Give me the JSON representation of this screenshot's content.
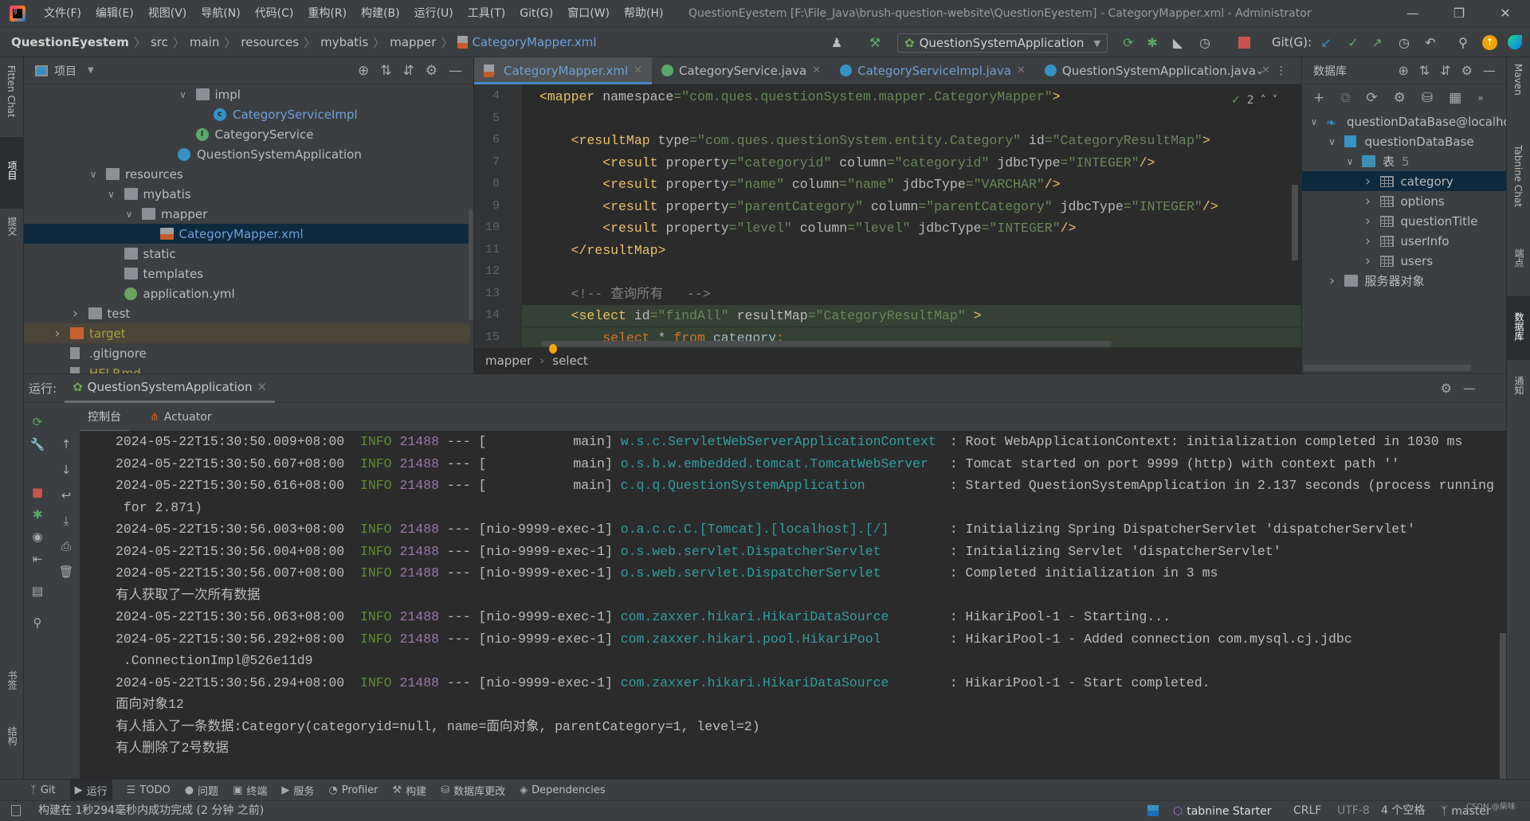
{
  "menu": [
    "文件(F)",
    "编辑(E)",
    "视图(V)",
    "导航(N)",
    "代码(C)",
    "重构(R)",
    "构建(B)",
    "运行(U)",
    "工具(T)",
    "Git(G)",
    "窗口(W)",
    "帮助(H)"
  ],
  "window_title": "QuestionEyestem [F:\\File_Java\\brush-question-website\\QuestionEyestem] - CategoryMapper.xml - Administrator",
  "breadcrumb": {
    "root": "QuestionEyestem",
    "parts": [
      "src",
      "main",
      "resources",
      "mybatis",
      "mapper"
    ],
    "current": "CategoryMapper.xml"
  },
  "toolbar": {
    "run_config": "QuestionSystemApplication",
    "git_label": "Git(G):"
  },
  "left_stripe": [
    "Fitten Chat",
    "项目",
    "提交",
    "书签",
    "结构"
  ],
  "right_stripe": [
    "Maven",
    "Tabnine Chat",
    "端点",
    "数据库",
    "通知"
  ],
  "project": {
    "title": "项目",
    "tree": [
      {
        "label": "impl",
        "depth": 7,
        "type": "folder",
        "expanded": true
      },
      {
        "label": "CategoryServiceImpl",
        "depth": 8,
        "type": "class",
        "color": "#6f9fd8"
      },
      {
        "label": "CategoryService",
        "depth": 7,
        "type": "interface"
      },
      {
        "label": "QuestionSystemApplication",
        "depth": 6,
        "type": "spring-class"
      },
      {
        "label": "resources",
        "depth": 2,
        "type": "folder",
        "expanded": true
      },
      {
        "label": "mybatis",
        "depth": 3,
        "type": "folder",
        "expanded": true
      },
      {
        "label": "mapper",
        "depth": 4,
        "type": "folder",
        "expanded": true
      },
      {
        "label": "CategoryMapper.xml",
        "depth": 5,
        "type": "xml",
        "selected": true,
        "color": "#6f9fd8"
      },
      {
        "label": "static",
        "depth": 3,
        "type": "folder"
      },
      {
        "label": "templates",
        "depth": 3,
        "type": "folder"
      },
      {
        "label": "application.yml",
        "depth": 3,
        "type": "yml"
      },
      {
        "label": "test",
        "depth": 1,
        "type": "folder",
        "expanded": false
      },
      {
        "label": "target",
        "depth": 0,
        "type": "folder-orange",
        "expanded": false,
        "excluded": true,
        "color": "#a8a13a"
      },
      {
        "label": ".gitignore",
        "depth": 0,
        "type": "file"
      },
      {
        "label": "HELP.md",
        "depth": 0,
        "type": "file",
        "color": "#a8a13a"
      }
    ]
  },
  "editor": {
    "tabs": [
      {
        "label": "CategoryMapper.xml",
        "icon": "xml-file-icon",
        "active": true
      },
      {
        "label": "CategoryService.java",
        "icon": "interface-icon"
      },
      {
        "label": "CategoryServiceImpl.java",
        "icon": "class-icon"
      },
      {
        "label": "QuestionSystemApplication.java",
        "icon": "spring-class-icon"
      }
    ],
    "inspection_count": "2",
    "lines": [
      {
        "n": "4",
        "tokens": [
          [
            "<mapper ",
            "tag"
          ],
          [
            "namespace",
            "attr"
          ],
          [
            "=\"com.ques.questionSystem.mapper.CategoryMapper\"",
            "val"
          ],
          [
            ">",
            "tag"
          ]
        ]
      },
      {
        "n": "5",
        "tokens": []
      },
      {
        "n": "6",
        "tokens": [
          [
            "    <resultMap ",
            "tag"
          ],
          [
            "type",
            "attr"
          ],
          [
            "=\"com.ques.questionSystem.entity.Category\" ",
            "val"
          ],
          [
            "id",
            "attr"
          ],
          [
            "=\"CategoryResultMap\"",
            "val"
          ],
          [
            ">",
            "tag"
          ]
        ]
      },
      {
        "n": "7",
        "tokens": [
          [
            "        <result ",
            "tag"
          ],
          [
            "property",
            "attr"
          ],
          [
            "=\"categoryid\" ",
            "val"
          ],
          [
            "column",
            "attr"
          ],
          [
            "=\"categoryid\" ",
            "val"
          ],
          [
            "jdbcType",
            "attr"
          ],
          [
            "=\"INTEGER\"",
            "val"
          ],
          [
            "/>",
            "tag"
          ]
        ]
      },
      {
        "n": "8",
        "tokens": [
          [
            "        <result ",
            "tag"
          ],
          [
            "property",
            "attr"
          ],
          [
            "=\"name\" ",
            "val"
          ],
          [
            "column",
            "attr"
          ],
          [
            "=\"name\" ",
            "val"
          ],
          [
            "jdbcType",
            "attr"
          ],
          [
            "=\"VARCHAR\"",
            "val"
          ],
          [
            "/>",
            "tag"
          ]
        ]
      },
      {
        "n": "9",
        "tokens": [
          [
            "        <result ",
            "tag"
          ],
          [
            "property",
            "attr"
          ],
          [
            "=\"parentCategory\" ",
            "val"
          ],
          [
            "column",
            "attr"
          ],
          [
            "=\"parentCategory\" ",
            "val"
          ],
          [
            "jdbcType",
            "attr"
          ],
          [
            "=\"INTEGER\"",
            "val"
          ],
          [
            "/>",
            "tag"
          ]
        ]
      },
      {
        "n": "10",
        "tokens": [
          [
            "        <result ",
            "tag"
          ],
          [
            "property",
            "attr"
          ],
          [
            "=\"level\" ",
            "val"
          ],
          [
            "column",
            "attr"
          ],
          [
            "=\"level\" ",
            "val"
          ],
          [
            "jdbcType",
            "attr"
          ],
          [
            "=\"INTEGER\"",
            "val"
          ],
          [
            "/>",
            "tag"
          ]
        ]
      },
      {
        "n": "11",
        "tokens": [
          [
            "    </resultMap>",
            "tag"
          ]
        ]
      },
      {
        "n": "12",
        "tokens": []
      },
      {
        "n": "13",
        "tokens": [
          [
            "    <!-- 查询所有   -->",
            "com"
          ]
        ]
      },
      {
        "n": "14",
        "tokens": [
          [
            "    <select ",
            "tag"
          ],
          [
            "id",
            "attr"
          ],
          [
            "=\"findAll\" ",
            "val"
          ],
          [
            "resultMap",
            "attr"
          ],
          [
            "=\"CategoryResultMap\" ",
            "val"
          ],
          [
            ">",
            "tag"
          ]
        ],
        "highlight": true
      },
      {
        "n": "15",
        "tokens": [
          [
            "        select ",
            "kw"
          ],
          [
            "* ",
            "pl"
          ],
          [
            "from ",
            "kw"
          ],
          [
            "category",
            "pl"
          ],
          [
            ";",
            "kw"
          ]
        ],
        "highlight": true
      }
    ],
    "breadcrumb": [
      "mapper",
      "select"
    ]
  },
  "database": {
    "title": "数据库",
    "tree": [
      {
        "label": "questionDataBase@localhost",
        "depth": 0,
        "type": "datasource",
        "expanded": true
      },
      {
        "label": "questionDataBase",
        "depth": 1,
        "type": "schema",
        "expanded": true
      },
      {
        "label": "表",
        "count": "5",
        "depth": 2,
        "type": "folder",
        "expanded": true
      },
      {
        "label": "category",
        "depth": 3,
        "type": "table",
        "selected": true
      },
      {
        "label": "options",
        "depth": 3,
        "type": "table"
      },
      {
        "label": "questionTitle",
        "depth": 3,
        "type": "table"
      },
      {
        "label": "userInfo",
        "depth": 3,
        "type": "table"
      },
      {
        "label": "users",
        "depth": 3,
        "type": "table"
      },
      {
        "label": "服务器对象",
        "depth": 1,
        "type": "server-objects",
        "expanded": false
      }
    ]
  },
  "run": {
    "label": "运行:",
    "tab": "QuestionSystemApplication",
    "subtabs": [
      "控制台",
      "Actuator"
    ],
    "console": [
      {
        "ts": "2024-05-22T15:30:50.009+08:00",
        "level": "INFO",
        "pid": "21488",
        "thread": "--- [           main]",
        "logger": "w.s.c.ServletWebServerApplicationContext",
        "msg": ": Root WebApplicationContext: initialization completed in 1030 ms"
      },
      {
        "ts": "2024-05-22T15:30:50.607+08:00",
        "level": "INFO",
        "pid": "21488",
        "thread": "--- [           main]",
        "logger": "o.s.b.w.embedded.tomcat.TomcatWebServer",
        "msg": ": Tomcat started on port 9999 (http) with context path ''"
      },
      {
        "ts": "2024-05-22T15:30:50.616+08:00",
        "level": "INFO",
        "pid": "21488",
        "thread": "--- [           main]",
        "logger": "c.q.q.QuestionSystemApplication",
        "msg": ": Started QuestionSystemApplication in 2.137 seconds (process running"
      },
      {
        "text": " for 2.871)"
      },
      {
        "ts": "2024-05-22T15:30:56.003+08:00",
        "level": "INFO",
        "pid": "21488",
        "thread": "--- [nio-9999-exec-1]",
        "logger": "o.a.c.c.C.[Tomcat].[localhost].[/]",
        "msg": ": Initializing Spring DispatcherServlet 'dispatcherServlet'"
      },
      {
        "ts": "2024-05-22T15:30:56.004+08:00",
        "level": "INFO",
        "pid": "21488",
        "thread": "--- [nio-9999-exec-1]",
        "logger": "o.s.web.servlet.DispatcherServlet",
        "msg": ": Initializing Servlet 'dispatcherServlet'"
      },
      {
        "ts": "2024-05-22T15:30:56.007+08:00",
        "level": "INFO",
        "pid": "21488",
        "thread": "--- [nio-9999-exec-1]",
        "logger": "o.s.web.servlet.DispatcherServlet",
        "msg": ": Completed initialization in 3 ms"
      },
      {
        "text": "有人获取了一次所有数据"
      },
      {
        "ts": "2024-05-22T15:30:56.063+08:00",
        "level": "INFO",
        "pid": "21488",
        "thread": "--- [nio-9999-exec-1]",
        "logger": "com.zaxxer.hikari.HikariDataSource",
        "msg": ": HikariPool-1 - Starting..."
      },
      {
        "ts": "2024-05-22T15:30:56.292+08:00",
        "level": "INFO",
        "pid": "21488",
        "thread": "--- [nio-9999-exec-1]",
        "logger": "com.zaxxer.hikari.pool.HikariPool",
        "msg": ": HikariPool-1 - Added connection com.mysql.cj.jdbc"
      },
      {
        "text": " .ConnectionImpl@526e11d9"
      },
      {
        "ts": "2024-05-22T15:30:56.294+08:00",
        "level": "INFO",
        "pid": "21488",
        "thread": "--- [nio-9999-exec-1]",
        "logger": "com.zaxxer.hikari.HikariDataSource",
        "msg": ": HikariPool-1 - Start completed."
      },
      {
        "text": "面向对象12"
      },
      {
        "text": "有人插入了一条数据:Category(categoryid=null, name=面向对象, parentCategory=1, level=2)"
      },
      {
        "text": "有人删除了2号数据"
      }
    ]
  },
  "bottom_tools": [
    {
      "label": "Git",
      "icon": "git-branch-icon"
    },
    {
      "label": "运行",
      "icon": "run-icon",
      "active": true
    },
    {
      "label": "TODO",
      "icon": "todo-icon"
    },
    {
      "label": "问题",
      "icon": "problems-icon"
    },
    {
      "label": "终端",
      "icon": "terminal-icon"
    },
    {
      "label": "服务",
      "icon": "services-icon"
    },
    {
      "label": "Profiler",
      "icon": "profiler-icon"
    },
    {
      "label": "构建",
      "icon": "build-icon"
    },
    {
      "label": "数据库更改",
      "icon": "database-changes-icon"
    },
    {
      "label": "Dependencies",
      "icon": "dependencies-icon"
    }
  ],
  "status": {
    "message": "构建在 1秒294毫秒内成功完成 (2 分钟 之前)",
    "tabnine": "tabnine Starter",
    "line_sep": "CRLF",
    "encoding": "UTF-8",
    "indent": "4 个空格",
    "branch": "master",
    "watermark": "CSDN @柴味"
  },
  "colors": {
    "accent": "#4a88c7",
    "selection": "#0d293e",
    "editor_bg": "#2b2b2b",
    "panel_bg": "#3c3f41"
  }
}
